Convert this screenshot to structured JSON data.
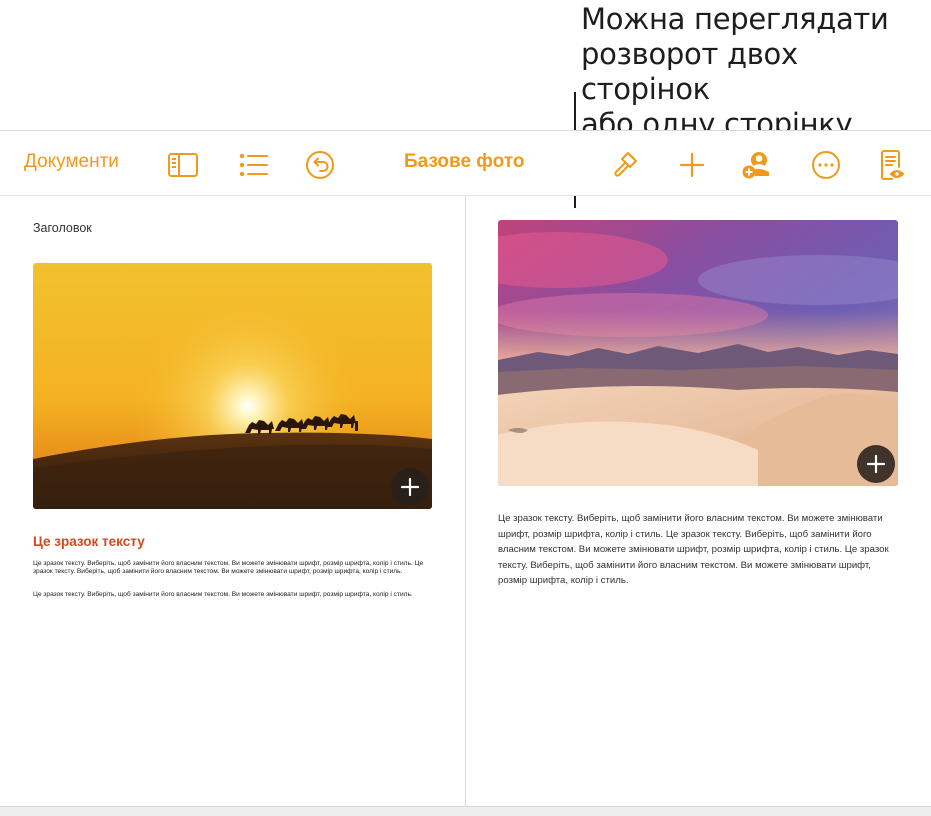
{
  "callout": {
    "text": "Можна переглядати\nрозворот двох сторінок\nабо одну сторінку."
  },
  "toolbar": {
    "documents_label": "Документи",
    "title": "Базове фото",
    "accent_color": "#ef9a1c",
    "icons": [
      "sidebar-icon",
      "list-icon",
      "undo-icon",
      "paintbrush-icon",
      "plus-icon",
      "add-person-icon",
      "more-icon",
      "reading-view-icon"
    ]
  },
  "left_page": {
    "header": "Заголовок",
    "subhead": "Це зразок тексту",
    "subhead_color": "#cf4a1f",
    "paragraph1": "Це зразок тексту. Виберіть, щоб замінити його власним текстом. Ви можете змінювати шрифт, розмір шрифта, колір і стиль. Це зразок тексту. Виберіть, щоб замінити його власним текстом. Ви можете змінювати шрифт, розмір шрифта, колір і стиль.",
    "paragraph2": "Це зразок тексту. Виберіть, щоб замінити його власним текстом. Ви можете змінювати шрифт, розмір шрифта, колір і стиль."
  },
  "right_page": {
    "paragraph": "Це зразок тексту. Виберіть, щоб замінити його власним текстом. Ви можете змінювати шрифт, розмір шрифта, колір і стиль. Це зразок тексту. Виберіть, щоб замінити його власним текстом. Ви можете змінювати шрифт, розмір шрифта, колір і стиль. Це зразок тексту. Виберіть, щоб замінити його власним текстом. Ви можете змінювати шрифт, розмір шрифта, колір і стиль."
  }
}
